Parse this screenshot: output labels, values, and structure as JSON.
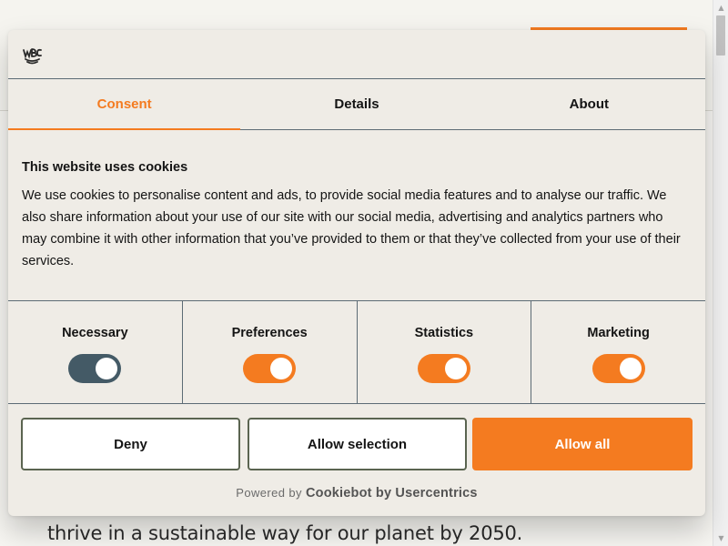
{
  "background": {
    "body_text": "thrive in a sustainable way for our planet by 2050."
  },
  "dialog": {
    "logo_icon": "wbc-logo-icon",
    "tabs": [
      {
        "label": "Consent",
        "active": true
      },
      {
        "label": "Details",
        "active": false
      },
      {
        "label": "About",
        "active": false
      }
    ],
    "title": "This website uses cookies",
    "description": "We use cookies to personalise content and ads, to provide social media features and to analyse our traffic. We also share information about your use of our site with our social media, advertising and analytics partners who may combine it with other information that you’ve provided to them or that they’ve collected from your use of their services.",
    "toggles": [
      {
        "label": "Necessary",
        "checked": true,
        "disabled": true,
        "color": "#445a66"
      },
      {
        "label": "Preferences",
        "checked": true,
        "disabled": false,
        "color": "#f47b20"
      },
      {
        "label": "Statistics",
        "checked": true,
        "disabled": false,
        "color": "#f47b20"
      },
      {
        "label": "Marketing",
        "checked": true,
        "disabled": false,
        "color": "#f47b20"
      }
    ],
    "buttons": {
      "deny": "Deny",
      "allow_selection": "Allow selection",
      "allow_all": "Allow all"
    },
    "powered_by": {
      "prefix": "Powered by",
      "brand": "Cookiebot by Usercentrics"
    }
  },
  "colors": {
    "accent": "#f47b20",
    "dialog_bg": "#efece6",
    "divider": "#5c6b75"
  }
}
